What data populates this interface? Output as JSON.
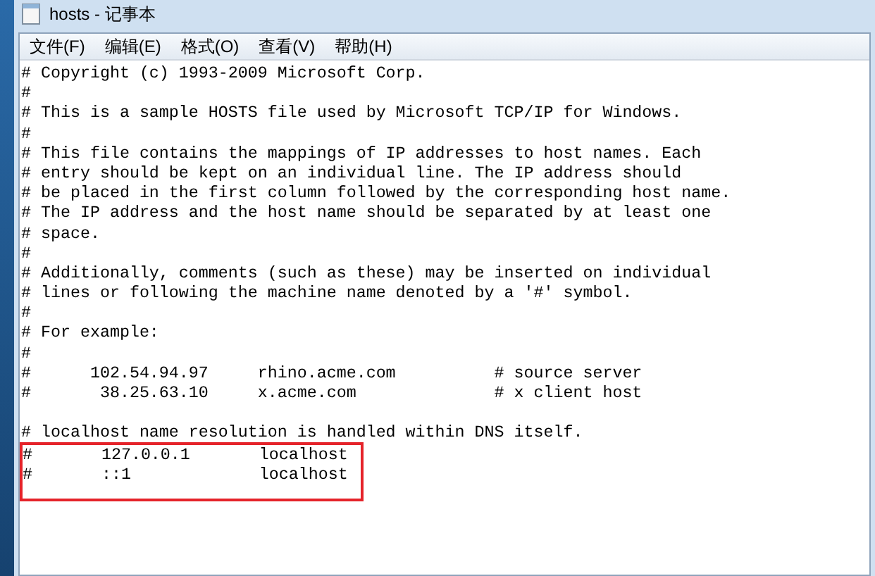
{
  "window": {
    "title": "hosts - 记事本"
  },
  "menu": [
    "文件(F)",
    "编辑(E)",
    "格式(O)",
    "查看(V)",
    "帮助(H)"
  ],
  "editor": {
    "blocks": [
      {
        "lines": [
          {
            "text": "# Copyright (c) 1993-2009 Microsoft Corp.",
            "highlighted": false
          },
          {
            "text": "#",
            "highlighted": false
          },
          {
            "text": "# This is a sample HOSTS file used by Microsoft TCP/IP for Windows.",
            "highlighted": false
          },
          {
            "text": "#",
            "highlighted": false
          },
          {
            "text": "# This file contains the mappings of IP addresses to host names. Each",
            "highlighted": false
          },
          {
            "text": "# entry should be kept on an individual line. The IP address should",
            "highlighted": false
          },
          {
            "text": "# be placed in the first column followed by the corresponding host name.",
            "highlighted": false
          },
          {
            "text": "# The IP address and the host name should be separated by at least one",
            "highlighted": false
          },
          {
            "text": "# space.",
            "highlighted": false
          },
          {
            "text": "#",
            "highlighted": false
          },
          {
            "text": "# Additionally, comments (such as these) may be inserted on individual",
            "highlighted": false
          },
          {
            "text": "# lines or following the machine name denoted by a '#' symbol.",
            "highlighted": false
          },
          {
            "text": "#",
            "highlighted": false
          },
          {
            "text": "# For example:",
            "highlighted": false
          },
          {
            "text": "#",
            "highlighted": false
          },
          {
            "text": "#      102.54.94.97     rhino.acme.com          # source server",
            "highlighted": false
          },
          {
            "text": "#       38.25.63.10     x.acme.com              # x client host",
            "highlighted": false
          }
        ]
      },
      {
        "lines": [
          {
            "text": "# localhost name resolution is handled within DNS itself.",
            "highlighted": false
          },
          {
            "text": "#       127.0.0.1       localhost",
            "highlighted": true
          },
          {
            "text": "#       ::1             localhost",
            "highlighted": true
          }
        ]
      }
    ]
  }
}
